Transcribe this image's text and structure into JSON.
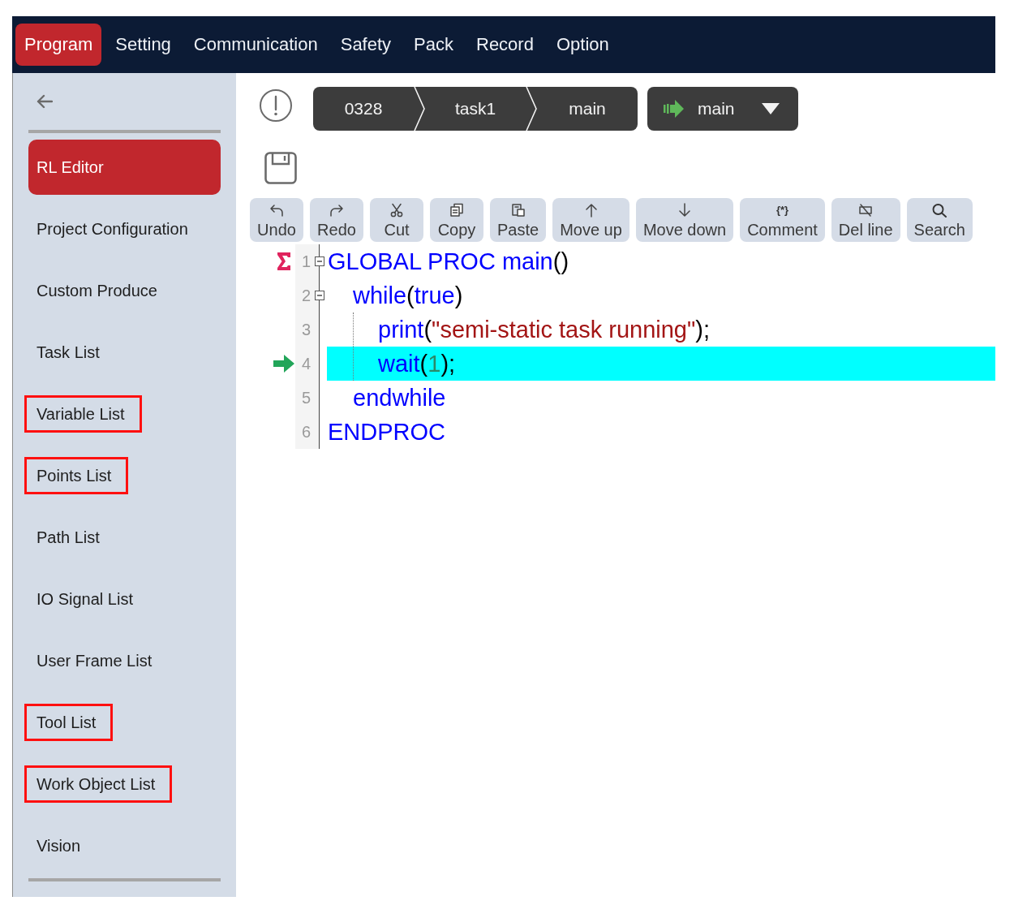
{
  "menu_bar": {
    "tabs": [
      {
        "label": "Program",
        "selected": true
      },
      {
        "label": "Setting",
        "selected": false
      },
      {
        "label": "Communication",
        "selected": false
      },
      {
        "label": "Safety",
        "selected": false
      },
      {
        "label": "Pack",
        "selected": false
      },
      {
        "label": "Record",
        "selected": false
      },
      {
        "label": "Option",
        "selected": false
      }
    ]
  },
  "sidebar": {
    "items": [
      {
        "label": "RL Editor",
        "selected": true,
        "highlighted": false
      },
      {
        "label": "Project Configuration",
        "selected": false,
        "highlighted": false
      },
      {
        "label": "Custom Produce",
        "selected": false,
        "highlighted": false
      },
      {
        "label": "Task List",
        "selected": false,
        "highlighted": false
      },
      {
        "label": "Variable List",
        "selected": false,
        "highlighted": true
      },
      {
        "label": "Points List",
        "selected": false,
        "highlighted": true
      },
      {
        "label": "Path List",
        "selected": false,
        "highlighted": false
      },
      {
        "label": "IO Signal List",
        "selected": false,
        "highlighted": false
      },
      {
        "label": "User Frame List",
        "selected": false,
        "highlighted": false
      },
      {
        "label": "Tool List",
        "selected": false,
        "highlighted": true
      },
      {
        "label": "Work Object List",
        "selected": false,
        "highlighted": true
      },
      {
        "label": "Vision",
        "selected": false,
        "highlighted": false
      }
    ]
  },
  "header": {
    "path": [
      "0328",
      "task1",
      "main"
    ],
    "routine_dropdown": {
      "value": "main"
    }
  },
  "toolbar": {
    "buttons": [
      {
        "label": "Undo"
      },
      {
        "label": "Redo"
      },
      {
        "label": "Cut"
      },
      {
        "label": "Copy"
      },
      {
        "label": "Paste"
      },
      {
        "label": "Move up"
      },
      {
        "label": "Move down"
      },
      {
        "label": "Comment",
        "glyph": "{*}"
      },
      {
        "label": "Del line"
      },
      {
        "label": "Search"
      }
    ]
  },
  "editor": {
    "lines": [
      {
        "number": "1",
        "motion_pointer": true,
        "program_pointer": false,
        "selected": false,
        "expanded": true,
        "tokens": [
          {
            "text": "GLOBAL PROC main",
            "kind": "keyword"
          },
          {
            "text": "()",
            "kind": "punct"
          }
        ],
        "children": [
          {
            "number": "2",
            "motion_pointer": false,
            "program_pointer": false,
            "selected": false,
            "expanded": true,
            "tokens": [
              {
                "text": "while",
                "kind": "keyword"
              },
              {
                "text": "(",
                "kind": "punct"
              },
              {
                "text": "true",
                "kind": "keyword"
              },
              {
                "text": ")",
                "kind": "punct"
              }
            ],
            "children": [
              {
                "number": "3",
                "motion_pointer": false,
                "program_pointer": false,
                "selected": false,
                "tokens": [
                  {
                    "text": "print",
                    "kind": "keyword"
                  },
                  {
                    "text": "(",
                    "kind": "punct"
                  },
                  {
                    "text": "\"semi-static task running\"",
                    "kind": "string"
                  },
                  {
                    "text": ");",
                    "kind": "punct"
                  }
                ]
              },
              {
                "number": "4",
                "motion_pointer": false,
                "program_pointer": true,
                "selected": true,
                "tokens": [
                  {
                    "text": "wait",
                    "kind": "keyword"
                  },
                  {
                    "text": "(",
                    "kind": "punct"
                  },
                  {
                    "text": "1",
                    "kind": "number"
                  },
                  {
                    "text": ");",
                    "kind": "punct"
                  }
                ]
              }
            ]
          },
          {
            "number": "5",
            "motion_pointer": false,
            "program_pointer": false,
            "selected": false,
            "tokens": [
              {
                "text": "endwhile",
                "kind": "keyword"
              }
            ]
          }
        ]
      },
      {
        "number": "6",
        "motion_pointer": false,
        "program_pointer": false,
        "selected": false,
        "tokens": [
          {
            "text": "ENDPROC",
            "kind": "keyword"
          }
        ]
      }
    ]
  }
}
